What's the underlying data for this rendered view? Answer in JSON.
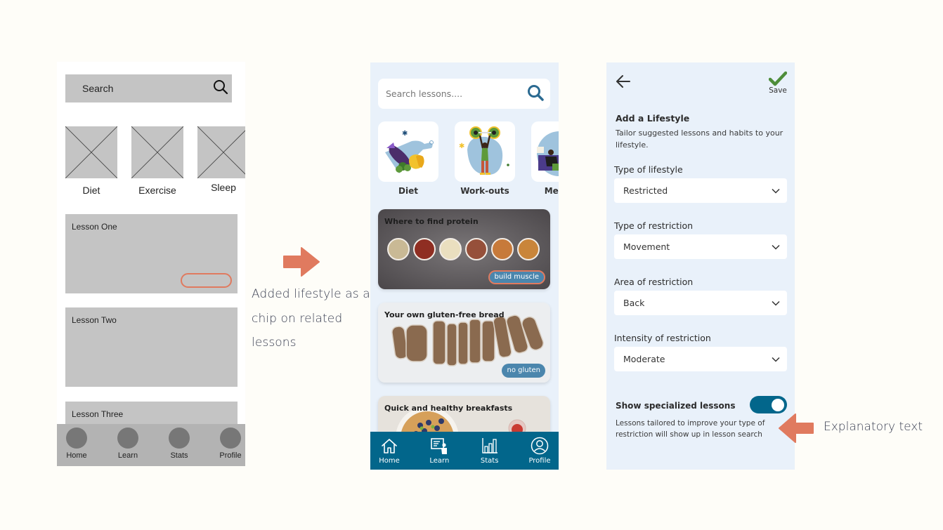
{
  "wireframe": {
    "search_label": "Search",
    "search_icon": "search-icon",
    "categories": [
      {
        "label": "Diet",
        "icon": "image-placeholder-icon"
      },
      {
        "label": "Exercise",
        "icon": "image-placeholder-icon"
      },
      {
        "label": "Sleep",
        "icon": "image-placeholder-icon"
      }
    ],
    "lessons": [
      {
        "title": "Lesson One",
        "has_chip": true
      },
      {
        "title": "Lesson Two",
        "has_chip": false
      },
      {
        "title": "Lesson Three",
        "has_chip": false
      }
    ],
    "nav": [
      {
        "label": "Home"
      },
      {
        "label": "Learn"
      },
      {
        "label": "Stats"
      },
      {
        "label": "Profile"
      }
    ]
  },
  "annotations": {
    "chip_note": "Added lifestyle as a chip on related lessons",
    "explanatory_note": "Explanatory text",
    "accent_color": "#e07a5f"
  },
  "learn_screen": {
    "search_placeholder": "Search lessons....",
    "search_icon": "search-icon",
    "categories": [
      {
        "label": "Diet",
        "icon": "diet-illustration"
      },
      {
        "label": "Work-outs",
        "icon": "workout-illustration"
      },
      {
        "label": "Mentor",
        "icon": "mentor-illustration"
      }
    ],
    "lessons": [
      {
        "title": "Where to find protein",
        "chip": "build muscle",
        "chip_highlighted": true
      },
      {
        "title": "Your own gluten-free bread",
        "chip": "no gluten",
        "chip_highlighted": false
      },
      {
        "title": "Quick and healthy breakfasts",
        "chip": null,
        "chip_highlighted": false
      }
    ],
    "nav": [
      {
        "label": "Home",
        "icon": "home-icon"
      },
      {
        "label": "Learn",
        "icon": "learn-icon"
      },
      {
        "label": "Stats",
        "icon": "stats-icon"
      },
      {
        "label": "Profile",
        "icon": "profile-icon"
      }
    ],
    "colors": {
      "nav": "#02668b",
      "chip": "#4b86ad",
      "background": "#e9f1fa"
    }
  },
  "lifestyle_screen": {
    "back_icon": "arrow-left-icon",
    "save_label": "Save",
    "save_icon": "checkmark-icon",
    "title": "Add a Lifestyle",
    "subtitle": "Tailor suggested lessons and habits to your lifestyle.",
    "fields": [
      {
        "label": "Type of lifestyle",
        "value": "Restricted"
      },
      {
        "label": "Type of restriction",
        "value": "Movement"
      },
      {
        "label": "Area of restriction",
        "value": "Back"
      },
      {
        "label": "Intensity of restriction",
        "value": "Moderate"
      }
    ],
    "toggle": {
      "label": "Show specialized lessons",
      "on": true,
      "description": "Lessons tailored to improve your type of restriction will show up in lesson search"
    },
    "colors": {
      "toggle": "#02668b",
      "save_check": "#4e8d3a"
    }
  }
}
